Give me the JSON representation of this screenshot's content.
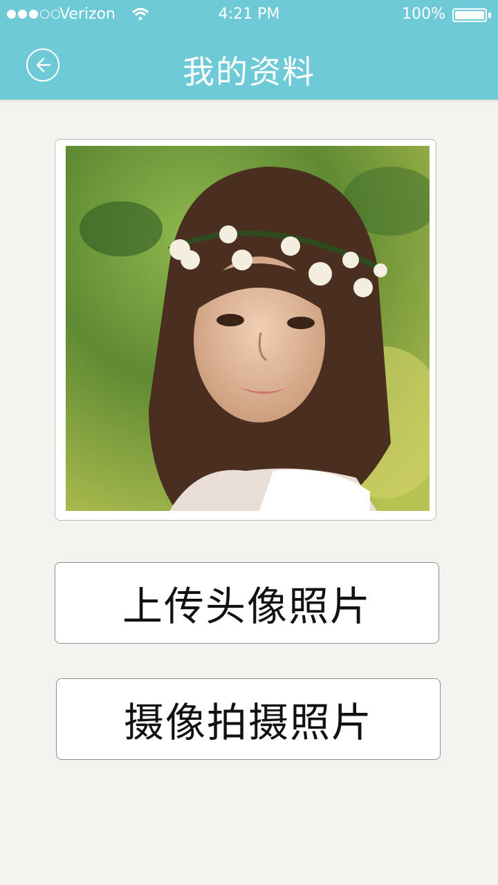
{
  "status_bar": {
    "carrier": "Verizon",
    "time": "4:21 PM",
    "battery": "100%"
  },
  "header": {
    "title": "我的资料",
    "back_icon": "arrow-left-circle-icon",
    "background_color": "#6ecad6"
  },
  "profile": {
    "photo_subject": "girl-with-flower-crown"
  },
  "actions": {
    "upload_label": "上传头像照片",
    "camera_label": "摄像拍摄照片"
  }
}
